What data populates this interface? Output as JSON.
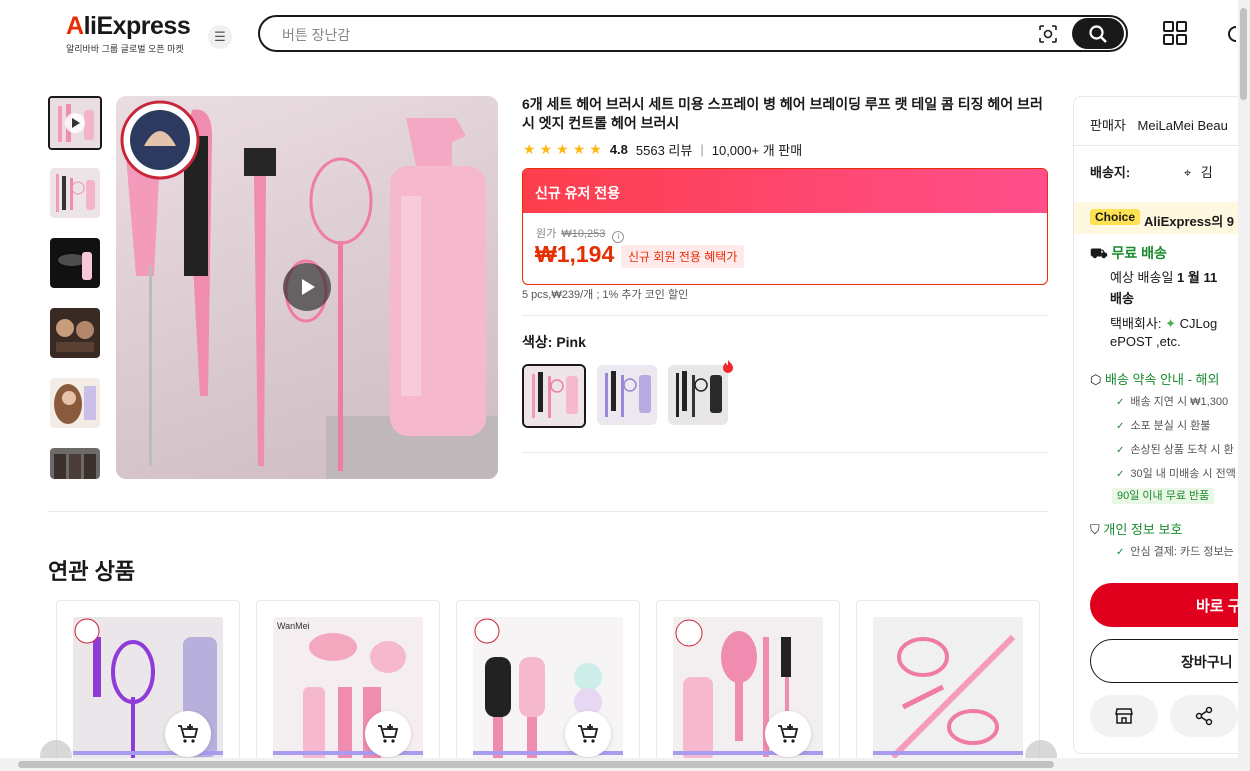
{
  "header": {
    "logo": "AliExpress",
    "logo_sub": "알리바바 그룹 글로벌 오픈 마켓",
    "search_placeholder": "버튼 장난감"
  },
  "product": {
    "title": "6개 세트 헤어 브러시 세트 미용 스프레이 병 헤어 브레이딩 루프 랫 테일 콤 티징 헤어 브러시 엣지 컨트롤 헤어 브러시",
    "rating": "4.8",
    "reviews": "5563 리뷰",
    "sold": "10,000+ 개 판매",
    "star_count": 5,
    "price_banner": "신규 유저 전용",
    "original_label": "원가",
    "original_price": "₩10,253",
    "price": "₩1,194",
    "promo_tag": "신규 회원 전용 혜택가",
    "coin_note": "5 pcs,₩239/개 ; 1% 추가 코인 할인",
    "color_label": "색상:",
    "color_value": "Pink",
    "swatches": [
      "Pink",
      "Purple",
      "Black"
    ]
  },
  "related": {
    "title": "연관 상품"
  },
  "panel": {
    "seller_label": "판매자",
    "seller_name": "MeiLaMei Beau",
    "ship_to_label": "배송지:",
    "ship_to_value": "김",
    "choice_tag": "Choice",
    "choice_text": "AliExpress의 9",
    "free_shipping": "무료 배송",
    "delivery_line1": "예상 배송일",
    "delivery_date": "1 월 11",
    "delivery_line2": "배송",
    "carrier_label": "택배회사:",
    "carrier_name": "CJLog",
    "carrier_line2": "ePOST ,etc.",
    "promise_title": "배송 약속 안내 - 해외",
    "promise_items": [
      "배송 지연 시 ₩1,300",
      "소포 분실 시 환불",
      "손상된 상품 도착 시 환",
      "30일 내 미배송 시 전액"
    ],
    "free_return": "90일 이내 무료 반품",
    "privacy_title": "개인 정보 보호",
    "privacy_item": "안심 결제: 카드 정보는",
    "buy_now": "바로 구",
    "add_cart": "장바구니"
  },
  "colors": {
    "accent": "#e62e04",
    "buy": "#e0001e",
    "green": "#1a8a2e"
  }
}
